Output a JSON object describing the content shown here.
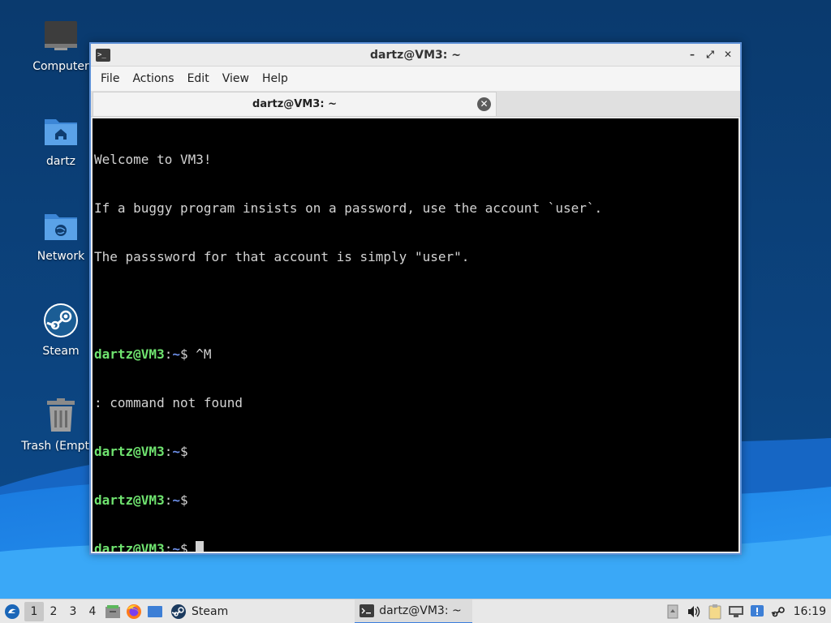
{
  "desktop": {
    "icons": [
      {
        "label": "Computer"
      },
      {
        "label": "dartz"
      },
      {
        "label": "Network"
      },
      {
        "label": "Steam"
      },
      {
        "label": "Trash (Empty)"
      }
    ]
  },
  "window": {
    "title": "dartz@VM3: ~",
    "controls": {
      "minimize": "–",
      "maximize": "⤢",
      "close": "✕"
    },
    "menu": [
      "File",
      "Actions",
      "Edit",
      "View",
      "Help"
    ],
    "tab": {
      "label": "dartz@VM3: ~",
      "close_glyph": "✕"
    },
    "terminal": {
      "welcome": [
        "Welcome to VM3!",
        "If a buggy program insists on a password, use the account `user`.",
        "The passsword for that account is simply \"user\"."
      ],
      "prompt_user": "dartz@VM3",
      "prompt_sep": ":",
      "prompt_path": "~",
      "prompt_sign": "$",
      "commands": [
        " ^M",
        "",
        "",
        " "
      ],
      "error_line": ": command not found"
    }
  },
  "taskbar": {
    "workspaces": [
      "1",
      "2",
      "3",
      "4"
    ],
    "active_workspace": "1",
    "launchers": [
      "file-manager-icon",
      "firefox-icon",
      "desktop-icon"
    ],
    "steam_label": "Steam",
    "task_label": "dartz@VM3: ~",
    "clock": "16:19"
  },
  "colors": {
    "accent": "#3b7ddd",
    "prompt_user": "#6fe36f",
    "prompt_path": "#6d8fe8",
    "terminal_bg": "#000000"
  }
}
